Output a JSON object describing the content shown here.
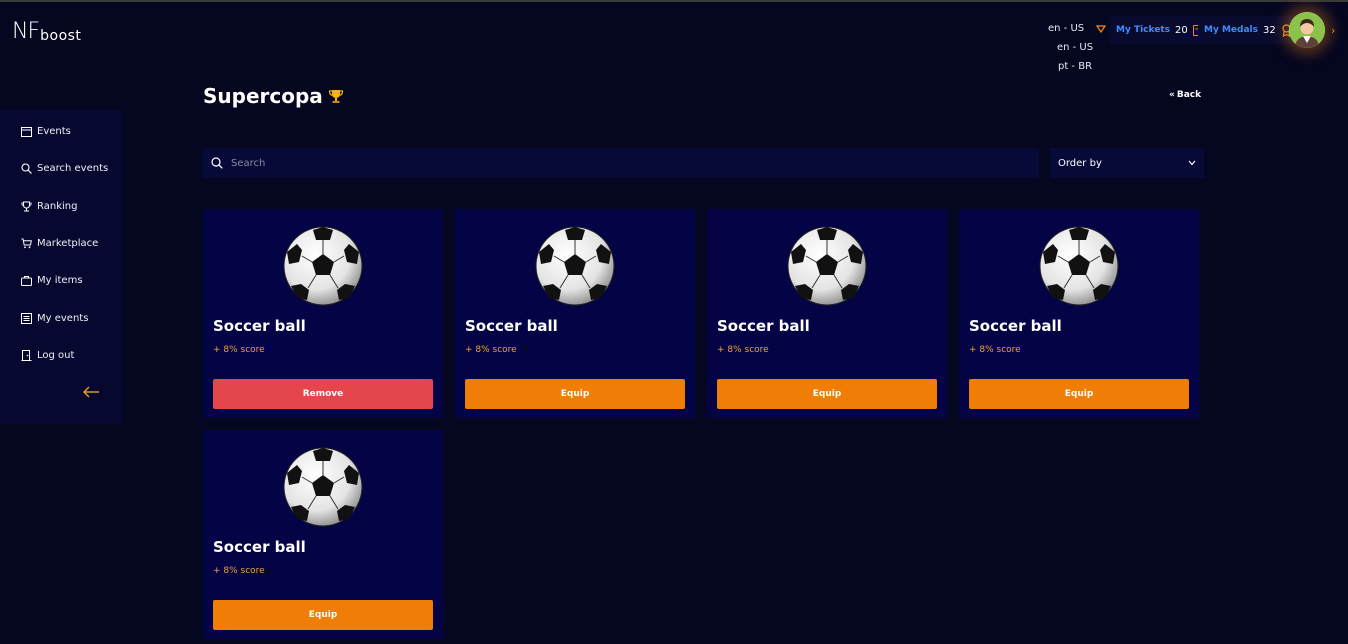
{
  "header": {
    "logo_main": "NF",
    "logo_sub": "boost",
    "language": {
      "selected": "en - US",
      "options": [
        "en - US",
        "pt - BR"
      ]
    },
    "tickets": {
      "label": "My Tickets",
      "count": "20"
    },
    "medals": {
      "label": "My Medals",
      "count": "32"
    }
  },
  "sidebar": {
    "items": [
      {
        "label": "Events",
        "icon": "calendar-icon"
      },
      {
        "label": "Search events",
        "icon": "search-icon"
      },
      {
        "label": "Ranking",
        "icon": "trophy-icon"
      },
      {
        "label": "Marketplace",
        "icon": "cart-icon"
      },
      {
        "label": "My items",
        "icon": "bag-icon"
      },
      {
        "label": "My events",
        "icon": "list-icon"
      },
      {
        "label": "Log out",
        "icon": "logout-icon"
      }
    ]
  },
  "page": {
    "title": "Supercopa",
    "back_label": "Back",
    "search_placeholder": "Search",
    "order_label": "Order by"
  },
  "items": [
    {
      "name": "Soccer ball",
      "bonus": "+ 8% score",
      "action": "Remove"
    },
    {
      "name": "Soccer ball",
      "bonus": "+ 8% score",
      "action": "Equip"
    },
    {
      "name": "Soccer ball",
      "bonus": "+ 8% score",
      "action": "Equip"
    },
    {
      "name": "Soccer ball",
      "bonus": "+ 8% score",
      "action": "Equip"
    },
    {
      "name": "Soccer ball",
      "bonus": "+ 8% score",
      "action": "Equip"
    }
  ],
  "colors": {
    "background": "#050620",
    "card": "#040345",
    "accent_orange": "#ef7d06",
    "remove_red": "#e5464b",
    "link_blue": "#3c8cff"
  }
}
